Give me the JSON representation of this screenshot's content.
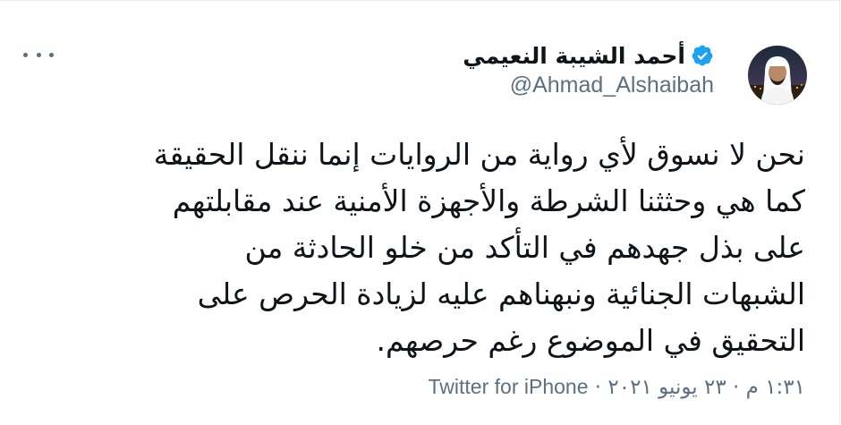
{
  "author": {
    "display_name": "أحمد الشيبة النعيمي",
    "handle": "@Ahmad_Alshaibah",
    "verified": true
  },
  "tweet": {
    "lines": [
      "نحن لا نسوق لأي رواية من الروايات إنما ننقل الحقيقة",
      "كما هي وحثثنا الشرطة والأجهزة الأمنية عند  مقابلتهم",
      "على بذل جهدهم في التأكد من خلو الحادثة من",
      "الشبهات الجنائية ونبهناهم عليه لزيادة الحرص على",
      "التحقيق في الموضوع رغم حرصهم."
    ],
    "timestamp": "١:٣١ م · ٢٣ يونيو ٢٠٢١",
    "separator": "·",
    "source": "Twitter for iPhone"
  },
  "icons": {
    "more": "more-options-icon",
    "verified": "verified-badge-icon"
  },
  "colors": {
    "text": "#0f1419",
    "secondary": "#5b7083",
    "verified": "#1da1f2"
  }
}
